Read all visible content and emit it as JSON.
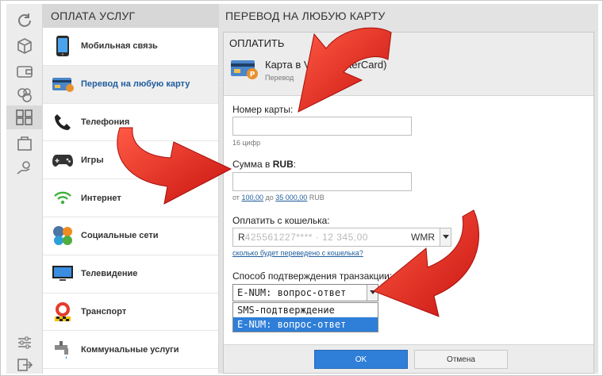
{
  "sidebar": {
    "header": "ОПЛАТА УСЛУГ",
    "items": [
      {
        "label": "Мобильная связь",
        "icon": "mobile-phone-icon"
      },
      {
        "label": "Перевод на любую карту",
        "icon": "bank-card-icon"
      },
      {
        "label": "Телефония",
        "icon": "telephone-handset-icon"
      },
      {
        "label": "Игры",
        "icon": "gamepad-icon"
      },
      {
        "label": "Интернет",
        "icon": "wifi-icon"
      },
      {
        "label": "Социальные сети",
        "icon": "social-networks-icon"
      },
      {
        "label": "Телевидение",
        "icon": "tv-icon"
      },
      {
        "label": "Транспорт",
        "icon": "taxi-icon"
      },
      {
        "label": "Коммунальные услуги",
        "icon": "faucet-icon"
      }
    ],
    "active_index": 1
  },
  "panel": {
    "header": "ПЕРЕВОД НА ЛЮБУЮ КАРТУ",
    "dialog_title": "ОПЛАТИТЬ",
    "card_title": "Карта в      Visa, MasterCard)",
    "card_subtitle": "Перевод",
    "card_number_label": "Номер карты:",
    "card_number_value": "",
    "card_number_hint": "16 цифр",
    "amount_label_prefix": "Сумма в ",
    "amount_label_currency": "RUB",
    "amount_label_suffix": ":",
    "amount_value": "",
    "amount_hint_from": "от ",
    "amount_hint_min": "100,00",
    "amount_hint_to": " до ",
    "amount_hint_max": "35 000,00",
    "amount_hint_currency": " RUB",
    "wallet_label": "Оплатить с кошелька:",
    "wallet_prefix": "R",
    "wallet_hidden": "425561227****  ·  12 345,00",
    "wallet_currency": "WMR",
    "transfer_link": "сколько будет переведено с кошелька?",
    "confirm_label": "Способ подтверждения транзакции:",
    "confirm_selected": "E-NUM: вопрос-ответ",
    "confirm_options": [
      "SMS-подтверждение",
      "E-NUM: вопрос-ответ"
    ],
    "ok_label": "OK",
    "cancel_label": "Отмена"
  },
  "colors": {
    "accent": "#2f7fd8",
    "link": "#1f5c9c",
    "arrow_red": "#e8271b"
  }
}
